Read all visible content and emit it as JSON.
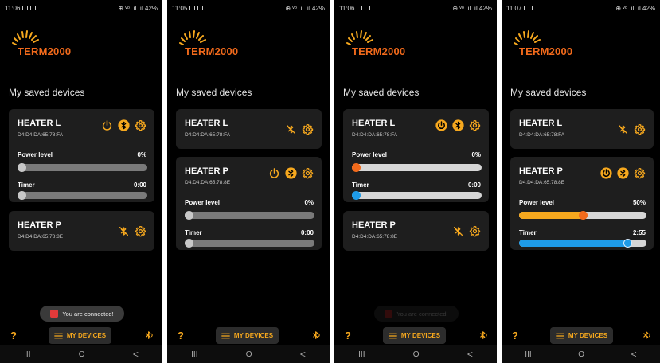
{
  "app": {
    "brand": "TERM2000",
    "section_title": "My saved devices",
    "toast": "You are connected!",
    "help_label": "?",
    "bottom_button": "MY DEVICES",
    "status_indicators": "⊕ ᵛᵒ .ıl .ıl 42%",
    "nav": {
      "recents": "III",
      "home": "O",
      "back": "<"
    }
  },
  "labels": {
    "power": "Power level",
    "timer": "Timer"
  },
  "colors": {
    "accent": "#f6a81e",
    "orange": "#f26a1b",
    "blue": "#1e9be8",
    "card": "#1e1e1e",
    "track": "#7a7a7a",
    "track_light": "#d6d6d6"
  },
  "screens": [
    {
      "time": "11:06",
      "heater_l": {
        "name": "HEATER L",
        "mac": "D4:D4:DA:65:78:FA",
        "power_value": "0%",
        "timer_value": "0:00",
        "power": 0,
        "timer": 0
      },
      "heater_p": {
        "name": "HEATER P",
        "mac": "D4:D4:DA:65:78:8E"
      }
    },
    {
      "time": "11:05",
      "heater_l": {
        "name": "HEATER L",
        "mac": "D4:D4:DA:65:78:FA"
      },
      "heater_p": {
        "name": "HEATER P",
        "mac": "D4:D4:DA:65:78:8E",
        "power_value": "0%",
        "timer_value": "0:00",
        "power": 0,
        "timer": 0
      }
    },
    {
      "time": "11:06",
      "heater_l": {
        "name": "HEATER L",
        "mac": "D4:D4:DA:65:78:FA",
        "power_value": "0%",
        "timer_value": "0:00",
        "power": 0,
        "timer": 0
      },
      "heater_p": {
        "name": "HEATER P",
        "mac": "D4:D4:DA:65:78:8E"
      }
    },
    {
      "time": "11:07",
      "heater_l": {
        "name": "HEATER L",
        "mac": "D4:D4:DA:65:78:FA"
      },
      "heater_p": {
        "name": "HEATER P",
        "mac": "D4:D4:DA:65:78:8E",
        "power_value": "50%",
        "timer_value": "2:55",
        "power": 0.5,
        "timer": 0.88
      }
    }
  ]
}
